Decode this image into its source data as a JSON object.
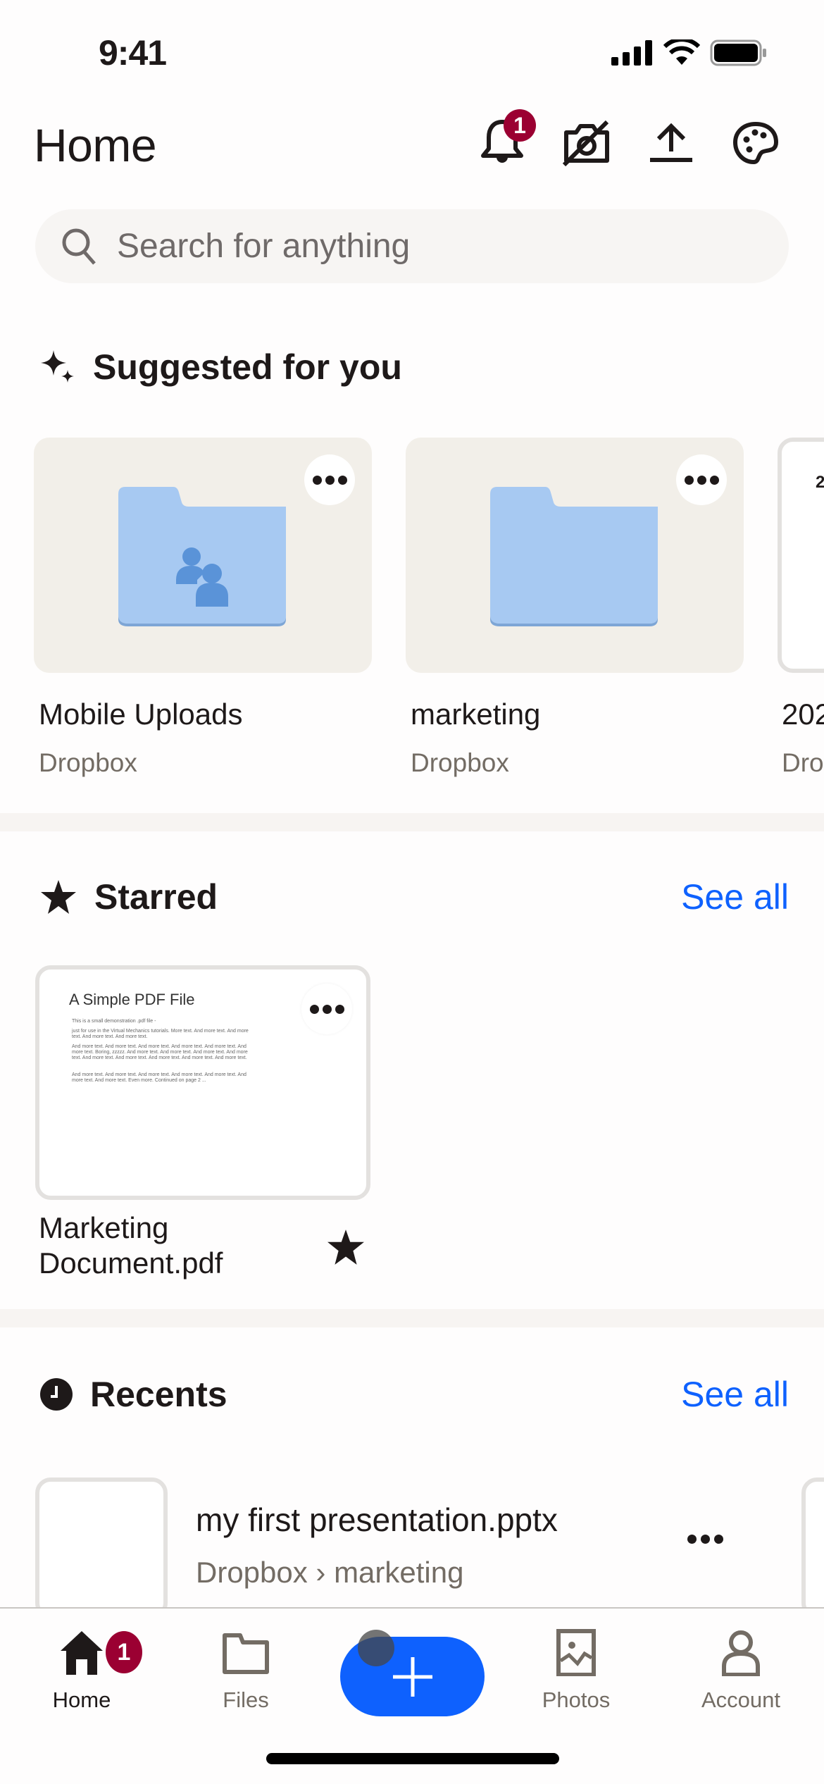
{
  "status_bar": {
    "time": "9:41"
  },
  "header": {
    "title": "Home",
    "notification_count": "1",
    "icons": [
      "bell-icon",
      "camera-off-icon",
      "upload-icon",
      "palette-icon"
    ]
  },
  "search": {
    "placeholder": "Search for anything",
    "value": ""
  },
  "suggested": {
    "title": "Suggested for you",
    "items": [
      {
        "name": "Mobile Uploads",
        "location": "Dropbox",
        "type": "shared-folder"
      },
      {
        "name": "marketing",
        "location": "Dropbox",
        "type": "folder"
      },
      {
        "name": "202",
        "location": "Dro",
        "type": "document",
        "preview_text": "2"
      }
    ]
  },
  "starred": {
    "title": "Starred",
    "see_all": "See all",
    "items": [
      {
        "name_line1": "Marketing",
        "name_line2": "Document.pdf",
        "preview": {
          "title": "A Simple PDF File",
          "lines": [
            "This is a small demonstration .pdf file -",
            "just for use in the Virtual Mechanics tutorials. More text. And more text. And more text. And more text. And more text.",
            "And more text. And more text. And more text. And more text. And more text. And more text. Boring, zzzzz. And more text. And more text. And more text. And more text. And more text. And more text. And more text. And more text. And more text.",
            "And more text. And more text. And more text. And more text. And more text. And more text. And more text. Even more. Continued on page 2 ..."
          ]
        }
      }
    ]
  },
  "recents": {
    "title": "Recents",
    "see_all": "See all",
    "items": [
      {
        "name": "my first presentation.pptx",
        "path": "Dropbox › marketing"
      }
    ]
  },
  "bottom_nav": {
    "items": [
      {
        "label": "Home",
        "active": true,
        "badge": "1"
      },
      {
        "label": "Files",
        "active": false
      },
      {
        "label": "Photos",
        "active": false
      },
      {
        "label": "Account",
        "active": false
      }
    ]
  },
  "colors": {
    "accent": "#0e61fe",
    "badge": "#9b0032",
    "folder": "#a7c9f2",
    "folder_people": "#5a93d8",
    "card_bg": "#f2efe9"
  }
}
